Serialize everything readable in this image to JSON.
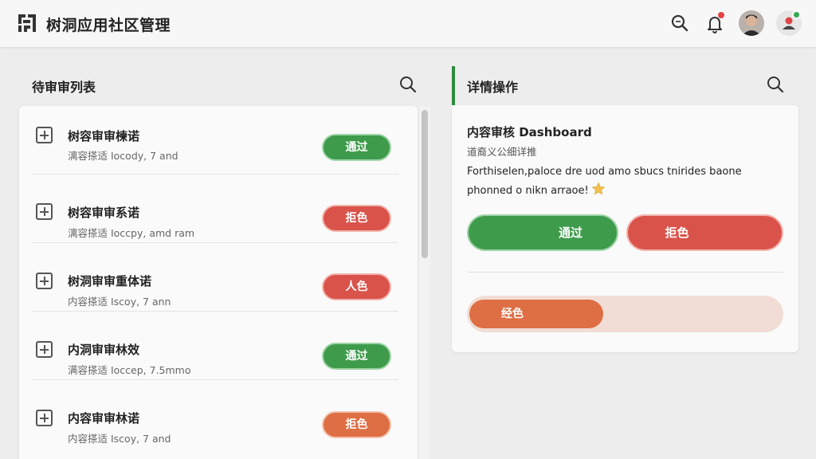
{
  "header": {
    "app_title": "树洞应用社区管理",
    "icons": [
      "logo-icon",
      "search-icon",
      "bell-icon",
      "avatar",
      "user-icon"
    ],
    "notification_dot_color": "#e0454a",
    "online_badge_color": "#34a853"
  },
  "left_panel": {
    "title": "待审审列表",
    "items": [
      {
        "title": "树容审审楝诺",
        "subtitle": "漓容搽适 Iocody, 7 and",
        "action": "通过",
        "status": "green"
      },
      {
        "title": "树容审审系诺",
        "subtitle": "漓容搽适 Ioccpy, amd ram",
        "action": "拒色",
        "status": "red"
      },
      {
        "title": "树洞审审重体诺",
        "subtitle": "内容搽适 Iscoy, 7 ann",
        "action": "人色",
        "status": "red"
      },
      {
        "title": "内洞审审林效",
        "subtitle": "满容搽适 Ioccep, 7.5mmo",
        "action": "通过",
        "status": "green"
      },
      {
        "title": "内容审审林诺",
        "subtitle": "内容搽适 Iscoy, 7 and",
        "action": "拒色",
        "status": "orange"
      }
    ]
  },
  "right_panel": {
    "title": "详情操作",
    "detail_title": "内容审核 Dashboard",
    "detail_subtitle": "道裔义公细详推",
    "detail_desc": "Forthiselen,paloce dre uod amo sbucs tnirides baone phonned o nikn arraoe!",
    "approve_label": "通过",
    "reject_label": "拒色",
    "progress_label": "经色",
    "progress_fraction": 0.43
  },
  "colors": {
    "approve": "#3e9b4c",
    "reject": "#d9534a",
    "warning": "#de6e43",
    "accent": "#2e8b3f"
  }
}
